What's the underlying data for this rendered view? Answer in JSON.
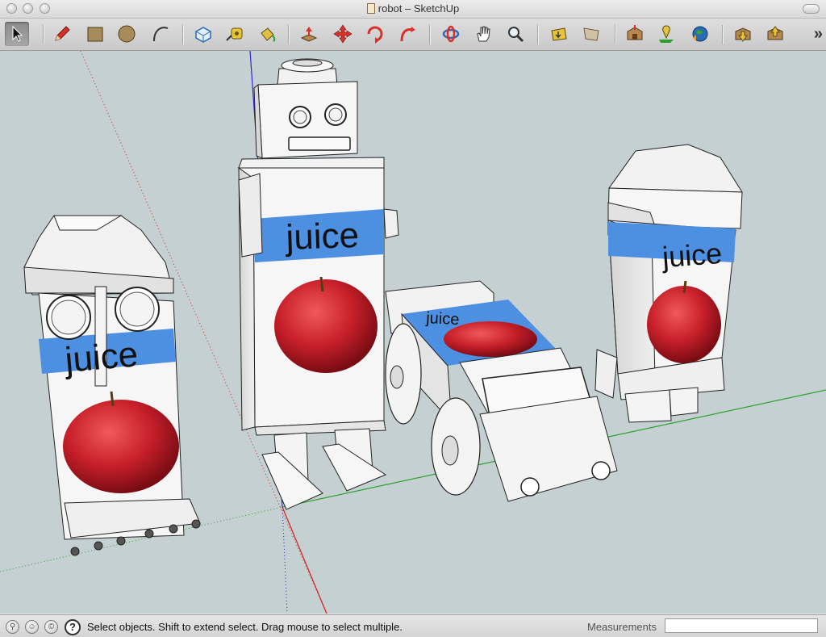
{
  "window": {
    "title": "robot – SketchUp"
  },
  "toolbar": {
    "tools": [
      {
        "name": "select-tool",
        "icon": "arrow-cursor-icon",
        "label": "Select"
      },
      {
        "name": "pencil-tool",
        "icon": "pencil-icon",
        "label": "Line"
      },
      {
        "name": "rectangle-tool",
        "icon": "rectangle-icon",
        "label": "Rectangle"
      },
      {
        "name": "circle-tool",
        "icon": "circle-icon",
        "label": "Circle"
      },
      {
        "name": "arc-tool",
        "icon": "arc-icon",
        "label": "Arc"
      },
      {
        "name": "make-component-tool",
        "icon": "component-icon",
        "label": "Make Component"
      },
      {
        "name": "tape-measure-tool",
        "icon": "tape-measure-icon",
        "label": "Tape Measure"
      },
      {
        "name": "paint-bucket-tool",
        "icon": "paint-bucket-icon",
        "label": "Paint Bucket"
      },
      {
        "name": "push-pull-tool",
        "icon": "push-pull-icon",
        "label": "Push/Pull"
      },
      {
        "name": "move-tool",
        "icon": "move-icon",
        "label": "Move"
      },
      {
        "name": "rotate-tool",
        "icon": "rotate-icon",
        "label": "Rotate"
      },
      {
        "name": "follow-me-tool",
        "icon": "follow-me-icon",
        "label": "Follow Me"
      },
      {
        "name": "orbit-tool",
        "icon": "orbit-icon",
        "label": "Orbit"
      },
      {
        "name": "pan-tool",
        "icon": "hand-icon",
        "label": "Pan"
      },
      {
        "name": "zoom-tool",
        "icon": "magnifier-icon",
        "label": "Zoom"
      },
      {
        "name": "previous-view-tool",
        "icon": "previous-view-icon",
        "label": "Previous"
      },
      {
        "name": "next-view-tool",
        "icon": "next-view-icon",
        "label": "Next"
      },
      {
        "name": "get-models-tool",
        "icon": "warehouse-icon",
        "label": "Get Models"
      },
      {
        "name": "add-location-tool",
        "icon": "location-pin-icon",
        "label": "Add Location"
      },
      {
        "name": "preview-google-earth-tool",
        "icon": "google-earth-icon",
        "label": "Preview in Google Earth"
      },
      {
        "name": "share-model-tool",
        "icon": "share-model-icon",
        "label": "Share Model"
      },
      {
        "name": "share-component-tool",
        "icon": "share-component-icon",
        "label": "Share Component"
      }
    ],
    "overflow_label": "»"
  },
  "scene": {
    "labels": [
      "juice",
      "juice",
      "juice",
      "juice"
    ],
    "colors": {
      "sky": "#c5d0d3",
      "juice_band": "#4d8fe0",
      "apple": "#c8202a",
      "model_white": "#f4f4f4",
      "axis_red": "#d22020",
      "axis_green": "#2ea02e",
      "axis_blue": "#2a2ad0"
    }
  },
  "statusbar": {
    "icons": [
      "geo-location-icon",
      "credits-icon",
      "copyright-icon"
    ],
    "help_icon": "?",
    "message": "Select objects. Shift to extend select. Drag mouse to select multiple.",
    "measurements_label": "Measurements",
    "measurements_value": ""
  }
}
